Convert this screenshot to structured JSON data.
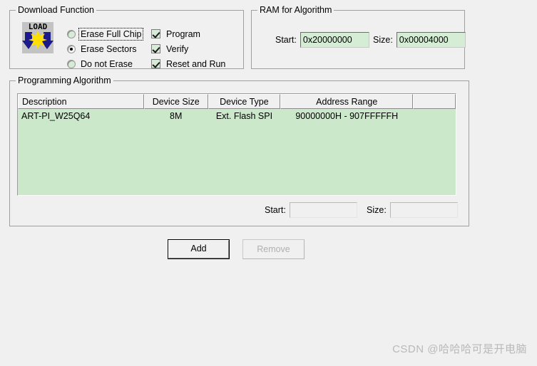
{
  "download_function": {
    "title": "Download Function",
    "icon_name": "load-icon",
    "icon_text": "LOAD",
    "erase_options": [
      {
        "label": "Erase Full Chip",
        "selected": false,
        "focused": true
      },
      {
        "label": "Erase Sectors",
        "selected": true,
        "focused": false
      },
      {
        "label": "Do not Erase",
        "selected": false,
        "focused": false
      }
    ],
    "action_options": [
      {
        "label": "Program",
        "checked": true
      },
      {
        "label": "Verify",
        "checked": true
      },
      {
        "label": "Reset and Run",
        "checked": true
      }
    ]
  },
  "ram_for_algorithm": {
    "title": "RAM for Algorithm",
    "start_label": "Start:",
    "start_value": "0x20000000",
    "size_label": "Size:",
    "size_value": "0x00004000"
  },
  "programming_algorithm": {
    "title": "Programming Algorithm",
    "columns": [
      "Description",
      "Device Size",
      "Device Type",
      "Address Range",
      ""
    ],
    "rows": [
      {
        "description": "ART-PI_W25Q64",
        "device_size": "8M",
        "device_type": "Ext. Flash SPI",
        "address_range": "90000000H - 907FFFFFH"
      }
    ],
    "start_label": "Start:",
    "start_value": "",
    "size_label": "Size:",
    "size_value": ""
  },
  "buttons": {
    "add_label": "Add",
    "remove_label": "Remove"
  },
  "watermark": {
    "text": "CSDN @哈哈哈可是开电脑"
  },
  "colors": {
    "dialog_bg": "#f0f0f0",
    "field_green": "#d4edd4",
    "list_green": "#cbe8cb",
    "border_gray": "#a0a0a0"
  }
}
